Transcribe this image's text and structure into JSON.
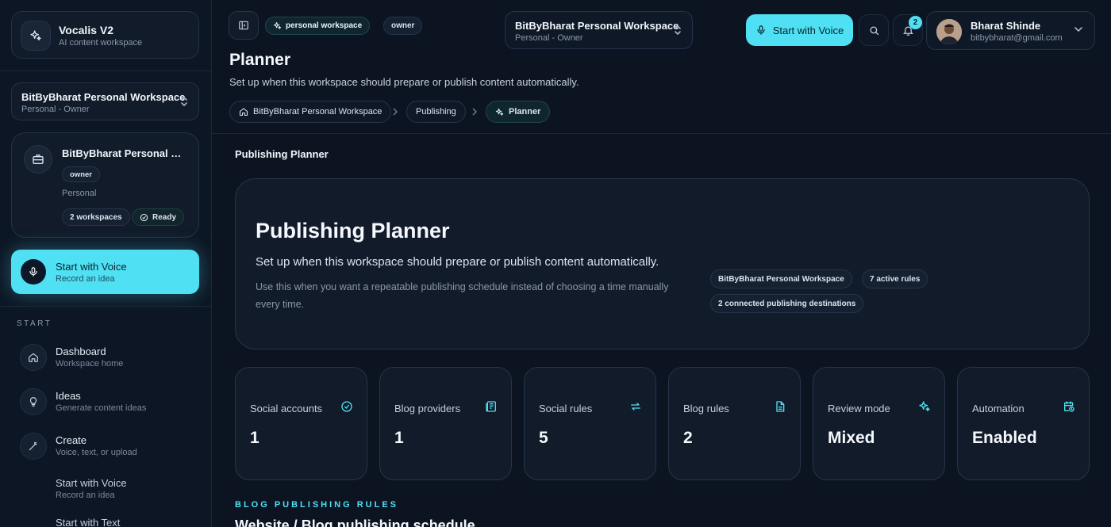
{
  "sidebar": {
    "brand": {
      "title": "Vocalis V2",
      "subtitle": "AI content workspace",
      "icon": "sparkles-icon"
    },
    "workspace_select": {
      "name": "BitByBharat Personal Workspace",
      "meta": "Personal - Owner"
    },
    "workspace_card": {
      "name": "BitByBharat Personal Wo...",
      "role": "owner",
      "type": "Personal",
      "count": "2 workspaces",
      "status": "Ready"
    },
    "voice_cta": {
      "title": "Start with Voice",
      "subtitle": "Record an idea"
    },
    "section_label": "START",
    "items": [
      {
        "title": "Dashboard",
        "subtitle": "Workspace home",
        "icon": "home-icon"
      },
      {
        "title": "Ideas",
        "subtitle": "Generate content ideas",
        "icon": "lightbulb-icon"
      },
      {
        "title": "Create",
        "subtitle": "Voice, text, or upload",
        "icon": "magic-wand-icon"
      },
      {
        "title": "Start with Voice",
        "subtitle": "Record an idea"
      },
      {
        "title": "Start with Text",
        "subtitle": ""
      }
    ]
  },
  "header": {
    "workspace_pill": "personal workspace",
    "role_pill": "owner",
    "workspace_switcher": {
      "name": "BitByBharat Personal Workspace",
      "meta": "Personal - Owner"
    },
    "voice_button": "Start with Voice",
    "notification_count": "2",
    "user": {
      "name": "Bharat Shinde",
      "email": "bitbybharat@gmail.com"
    }
  },
  "page": {
    "title": "Planner",
    "subtitle": "Set up when this workspace should prepare or publish content automatically.",
    "breadcrumb": [
      "BitByBharat Personal Workspace",
      "Publishing",
      "Planner"
    ]
  },
  "main": {
    "section_title": "Publishing Planner",
    "hero": {
      "title": "Publishing Planner",
      "subtitle": "Set up when this workspace should prepare or publish content automatically.",
      "description": "Use this when you want a repeatable publishing schedule instead of choosing a time manually every time.",
      "pills": [
        "BitByBharat Personal Workspace",
        "7 active rules",
        "2 connected publishing destinations"
      ]
    },
    "stats": [
      {
        "label": "Social accounts",
        "value": "1",
        "icon": "check-circle-icon"
      },
      {
        "label": "Blog providers",
        "value": "1",
        "icon": "newspaper-icon"
      },
      {
        "label": "Social rules",
        "value": "5",
        "icon": "repeat-icon"
      },
      {
        "label": "Blog rules",
        "value": "2",
        "icon": "document-icon"
      },
      {
        "label": "Review mode",
        "value": "Mixed",
        "icon": "sparkles-icon"
      },
      {
        "label": "Automation",
        "value": "Enabled",
        "icon": "calendar-clock-icon"
      }
    ],
    "rules_label": "BLOG PUBLISHING RULES",
    "rules_title": "Website / Blog publishing schedule"
  },
  "colors": {
    "accent": "#4fe0f3",
    "background": "#0c1422",
    "card": "#111b2a",
    "border": "#26344a"
  }
}
